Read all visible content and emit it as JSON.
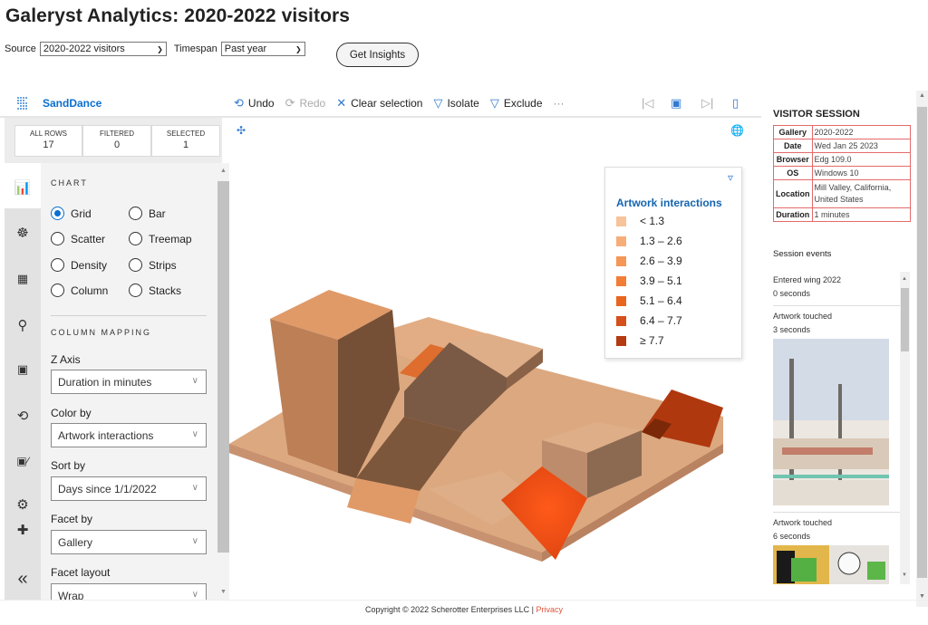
{
  "page": {
    "title": "Galeryst Analytics: 2020-2022 visitors",
    "source_label": "Source",
    "source_value": "2020-2022 visitors",
    "timespan_label": "Timespan",
    "timespan_value": "Past year",
    "insights_button": "Get Insights"
  },
  "sanddance": {
    "brand": "SandDance",
    "toolbar": {
      "undo": "Undo",
      "redo": "Redo",
      "clear_selection": "Clear selection",
      "isolate": "Isolate",
      "exclude": "Exclude",
      "more": "···"
    },
    "counts": [
      {
        "label": "ALL ROWS",
        "value": "17"
      },
      {
        "label": "FILTERED",
        "value": "0"
      },
      {
        "label": "SELECTED",
        "value": "1"
      }
    ],
    "rail_icons": [
      "chart-icon",
      "palette-icon",
      "table-icon",
      "search-icon",
      "camera-icon",
      "history-icon",
      "transition-icon",
      "settings-icon",
      "pin-icon",
      "collapse-icon"
    ],
    "chart_section": {
      "title": "CHART",
      "options": [
        {
          "label": "Grid",
          "selected": true
        },
        {
          "label": "Bar",
          "selected": false
        },
        {
          "label": "Scatter",
          "selected": false
        },
        {
          "label": "Treemap",
          "selected": false
        },
        {
          "label": "Density",
          "selected": false
        },
        {
          "label": "Strips",
          "selected": false
        },
        {
          "label": "Column",
          "selected": false
        },
        {
          "label": "Stacks",
          "selected": false
        }
      ]
    },
    "mapping_section": {
      "title": "COLUMN MAPPING",
      "fields": [
        {
          "label": "Z Axis",
          "value": "Duration in minutes"
        },
        {
          "label": "Color by",
          "value": "Artwork interactions"
        },
        {
          "label": "Sort by",
          "value": "Days since 1/1/2022"
        },
        {
          "label": "Facet by",
          "value": "Gallery"
        },
        {
          "label": "Facet layout",
          "value": "Wrap"
        }
      ]
    },
    "legend": {
      "title": "Artwork interactions",
      "items": [
        {
          "label": "< 1.3",
          "color": "#f7c49a"
        },
        {
          "label": "1.3 – 2.6",
          "color": "#f6ad78"
        },
        {
          "label": "2.6 – 3.9",
          "color": "#f59657"
        },
        {
          "label": "3.9 – 5.1",
          "color": "#f27d36"
        },
        {
          "label": "5.1 – 6.4",
          "color": "#e8651f"
        },
        {
          "label": "6.4 – 7.7",
          "color": "#d5501a"
        },
        {
          "label": "≥ 7.7",
          "color": "#b43a12"
        }
      ]
    }
  },
  "visitor_session": {
    "title": "VISITOR SESSION",
    "rows": [
      {
        "key": "Gallery",
        "value": "2020-2022"
      },
      {
        "key": "Date",
        "value": "Wed Jan 25 2023"
      },
      {
        "key": "Browser",
        "value": "Edg 109.0"
      },
      {
        "key": "OS",
        "value": "Windows 10"
      },
      {
        "key": "Location",
        "value": "Mill Valley, California, United States"
      },
      {
        "key": "Duration",
        "value": "1 minutes"
      }
    ],
    "events_title": "Session events",
    "events": [
      {
        "name": "Entered wing 2022",
        "time": "0 seconds"
      },
      {
        "name": "Artwork touched",
        "time": "3 seconds"
      },
      {
        "name": "Artwork touched",
        "time": "6 seconds"
      }
    ]
  },
  "footer": {
    "copyright": "Copyright © 2022 Scherotter Enterprises LLC | ",
    "privacy": "Privacy"
  }
}
